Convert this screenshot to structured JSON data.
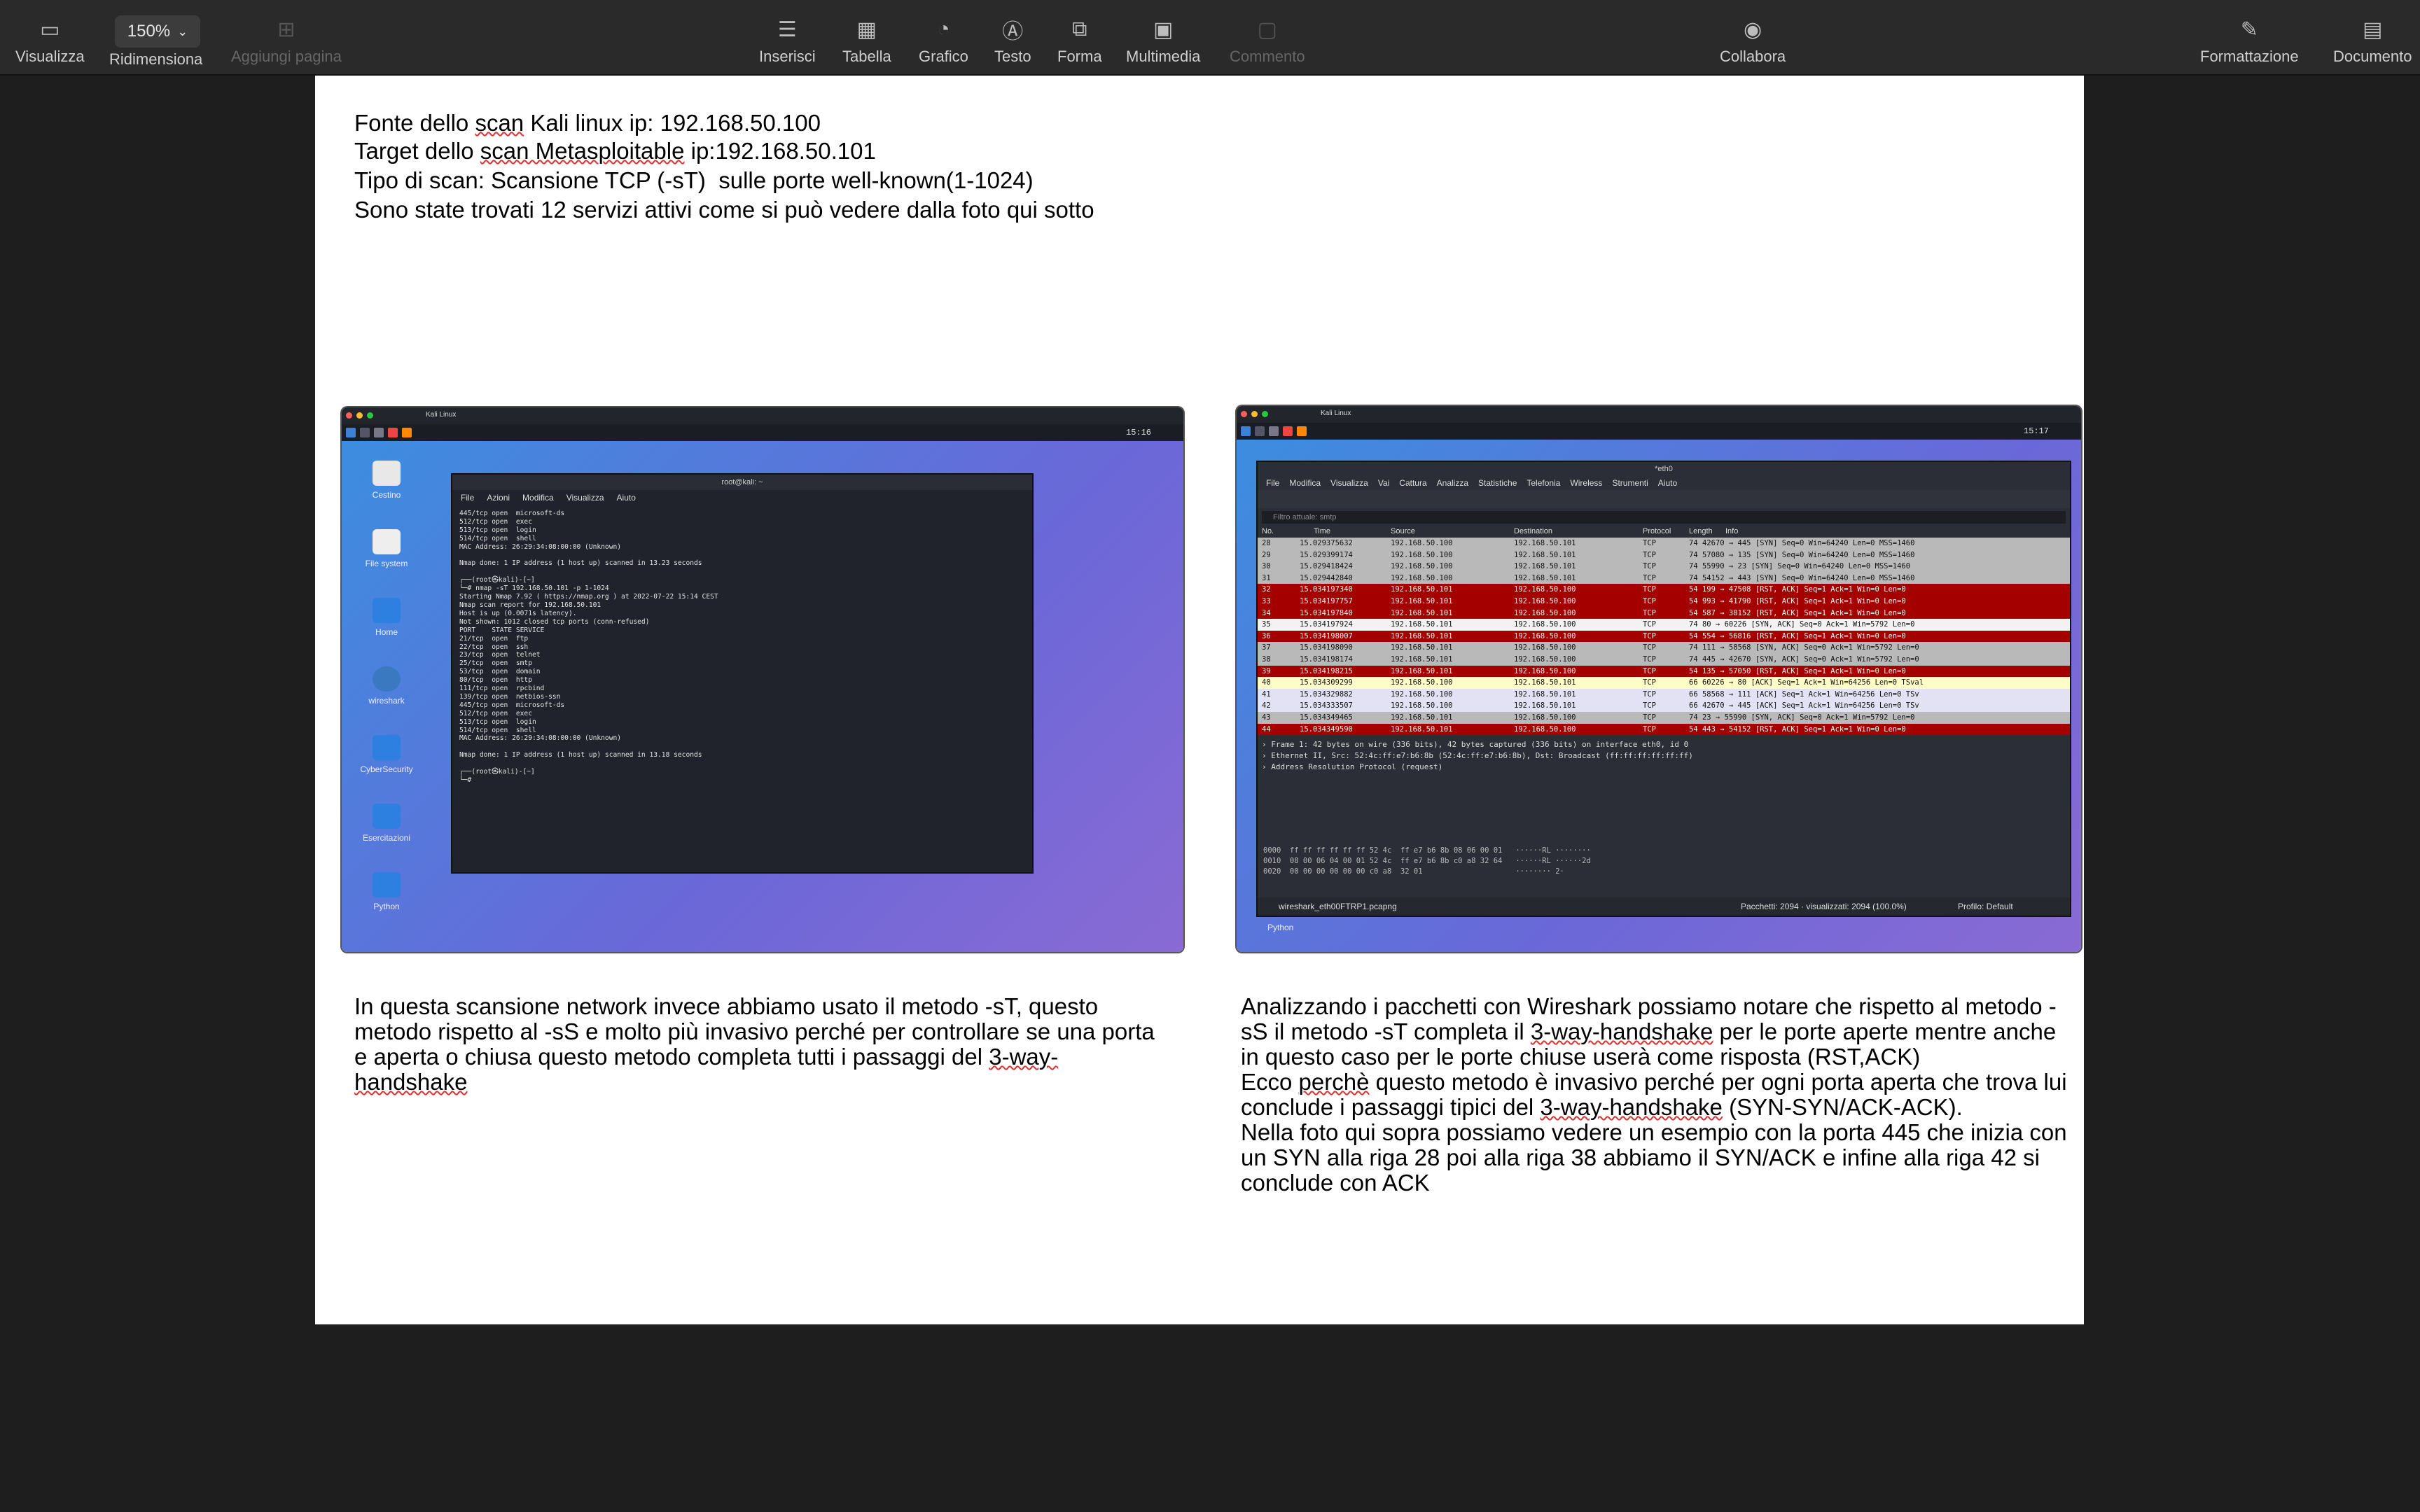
{
  "toolbar": {
    "view": "Visualizza",
    "zoom_value": "150%",
    "zoom_label": "Ridimensiona",
    "add_page": "Aggiungi pagina",
    "insert": "Inserisci",
    "table": "Tabella",
    "chart": "Grafico",
    "text": "Testo",
    "shape": "Forma",
    "media": "Multimedia",
    "comment": "Commento",
    "collaborate": "Collabora",
    "format": "Formattazione",
    "document": "Documento"
  },
  "intro": {
    "l1a": "Fonte dello ",
    "l1b": "scan",
    "l1c": " Kali linux ip: 192.168.50.100",
    "l2a": "Target dello ",
    "l2b": "scan Metasploitable",
    "l2c": " ip:192.168.50.101",
    "l3": "Tipo di scan: Scansione TCP (-sT)  sulle porte well-known(1-1024)",
    "l4": "Sono state trovati 12 servizi attivi come si può vedere dalla foto qui sotto"
  },
  "left_caption": {
    "a": "In questa scansione network invece abbiamo usato il metodo -sT, questo metodo rispetto al -sS e molto più invasivo perché per controllare se una porta e aperta o chiusa questo metodo completa tutti i passaggi del ",
    "b": "3-way-handshake"
  },
  "right_caption": {
    "a": "Analizzando i pacchetti con Wireshark possiamo notare che rispetto al metodo -sS il metodo -sT completa il ",
    "b": "3-way-handshake",
    "c": " per le porte aperte mentre anche in questo caso per le porte chiuse userà come risposta (RST,ACK)\nEcco ",
    "d": "perchè",
    "e": " questo metodo è invasivo perché per ogni porta aperta che trova lui conclude i passaggi tipici del ",
    "f": "3-way-handshake",
    "g": " (SYN-SYN/ACK-ACK).\nNella foto qui sopra possiamo vedere un esempio con la porta 445 che inizia con un SYN alla riga 28 poi alla riga 38 abbiamo il SYN/ACK e infine alla riga 42 si conclude con ACK"
  },
  "kali": {
    "window_title": "Kali Linux",
    "clock": "15:16",
    "desktop_icons": [
      "Cestino",
      "File system",
      "Home",
      "wireshark",
      "CyberSecurity",
      "Esercitazioni",
      "Python"
    ],
    "terminal_title": "root@kali: ~",
    "terminal_menu": [
      "File",
      "Azioni",
      "Modifica",
      "Visualizza",
      "Aiuto"
    ],
    "terminal_text": "445/tcp open  microsoft-ds\n512/tcp open  exec\n513/tcp open  login\n514/tcp open  shell\nMAC Address: 26:29:34:08:00:00 (Unknown)\n\nNmap done: 1 IP address (1 host up) scanned in 13.23 seconds\n\n┌──(root㉿kali)-[~]\n└─# nmap -sT 192.168.50.101 -p 1-1024\nStarting Nmap 7.92 ( https://nmap.org ) at 2022-07-22 15:14 CEST\nNmap scan report for 192.168.50.101\nHost is up (0.0071s latency).\nNot shown: 1012 closed tcp ports (conn-refused)\nPORT    STATE SERVICE\n21/tcp  open  ftp\n22/tcp  open  ssh\n23/tcp  open  telnet\n25/tcp  open  smtp\n53/tcp  open  domain\n80/tcp  open  http\n111/tcp open  rpcbind\n139/tcp open  netbios-ssn\n445/tcp open  microsoft-ds\n512/tcp open  exec\n513/tcp open  login\n514/tcp open  shell\nMAC Address: 26:29:34:08:00:00 (Unknown)\n\nNmap done: 1 IP address (1 host up) scanned in 13.18 seconds\n\n┌──(root㉿kali)-[~]\n└─# "
  },
  "wireshark": {
    "window_title": "Kali Linux",
    "clock": "15:17",
    "app_title": "*eth0",
    "menu": [
      "File",
      "Modifica",
      "Visualizza",
      "Vai",
      "Cattura",
      "Analizza",
      "Statistiche",
      "Telefonia",
      "Wireless",
      "Strumenti",
      "Aiuto"
    ],
    "filter_placeholder": "Filtro attuale: smtp",
    "columns": [
      "No.",
      "Time",
      "Source",
      "Destination",
      "Protocol",
      "Length",
      "Info"
    ],
    "packets": [
      {
        "no": "28",
        "time": "15.029375632",
        "src": "192.168.50.100",
        "dst": "192.168.50.101",
        "proto": "TCP",
        "info": "74 42670 → 445 [SYN] Seq=0 Win=64240 Len=0 MSS=1460",
        "bg": "#b9b9b9"
      },
      {
        "no": "29",
        "time": "15.029399174",
        "src": "192.168.50.100",
        "dst": "192.168.50.101",
        "proto": "TCP",
        "info": "74 57080 → 135 [SYN] Seq=0 Win=64240 Len=0 MSS=1460",
        "bg": "#b9b9b9"
      },
      {
        "no": "30",
        "time": "15.029418424",
        "src": "192.168.50.100",
        "dst": "192.168.50.101",
        "proto": "TCP",
        "info": "74 55990 → 23 [SYN] Seq=0 Win=64240 Len=0 MSS=1460",
        "bg": "#b9b9b9"
      },
      {
        "no": "31",
        "time": "15.029442840",
        "src": "192.168.50.100",
        "dst": "192.168.50.101",
        "proto": "TCP",
        "info": "74 54152 → 443 [SYN] Seq=0 Win=64240 Len=0 MSS=1460",
        "bg": "#b9b9b9"
      },
      {
        "no": "32",
        "time": "15.034197340",
        "src": "192.168.50.101",
        "dst": "192.168.50.100",
        "proto": "TCP",
        "info": "54 199 → 47508 [RST, ACK] Seq=1 Ack=1 Win=0 Len=0",
        "bg": "#a40000"
      },
      {
        "no": "33",
        "time": "15.034197757",
        "src": "192.168.50.101",
        "dst": "192.168.50.100",
        "proto": "TCP",
        "info": "54 993 → 41790 [RST, ACK] Seq=1 Ack=1 Win=0 Len=0",
        "bg": "#a40000"
      },
      {
        "no": "34",
        "time": "15.034197840",
        "src": "192.168.50.101",
        "dst": "192.168.50.100",
        "proto": "TCP",
        "info": "54 587 → 38152 [RST, ACK] Seq=1 Ack=1 Win=0 Len=0",
        "bg": "#a40000"
      },
      {
        "no": "35",
        "time": "15.034197924",
        "src": "192.168.50.101",
        "dst": "192.168.50.100",
        "proto": "TCP",
        "info": "74 80 → 60226 [SYN, ACK] Seq=0 Ack=1 Win=5792 Len=0",
        "bg": "#f2f2f2"
      },
      {
        "no": "36",
        "time": "15.034198007",
        "src": "192.168.50.101",
        "dst": "192.168.50.100",
        "proto": "TCP",
        "info": "54 554 → 56816 [RST, ACK] Seq=1 Ack=1 Win=0 Len=0",
        "bg": "#a40000"
      },
      {
        "no": "37",
        "time": "15.034198090",
        "src": "192.168.50.101",
        "dst": "192.168.50.100",
        "proto": "TCP",
        "info": "74 111 → 58568 [SYN, ACK] Seq=0 Ack=1 Win=5792 Len=0",
        "bg": "#b9b9b9"
      },
      {
        "no": "38",
        "time": "15.034198174",
        "src": "192.168.50.101",
        "dst": "192.168.50.100",
        "proto": "TCP",
        "info": "74 445 → 42670 [SYN, ACK] Seq=0 Ack=1 Win=5792 Len=0",
        "bg": "#b9b9b9"
      },
      {
        "no": "39",
        "time": "15.034198215",
        "src": "192.168.50.101",
        "dst": "192.168.50.100",
        "proto": "TCP",
        "info": "54 135 → 57050 [RST, ACK] Seq=1 Ack=1 Win=0 Len=0",
        "bg": "#a40000"
      },
      {
        "no": "40",
        "time": "15.034309299",
        "src": "192.168.50.100",
        "dst": "192.168.50.101",
        "proto": "TCP",
        "info": "66 60226 → 80 [ACK] Seq=1 Ack=1 Win=64256 Len=0 TSval",
        "bg": "#fdfdc8"
      },
      {
        "no": "41",
        "time": "15.034329882",
        "src": "192.168.50.100",
        "dst": "192.168.50.101",
        "proto": "TCP",
        "info": "66 58568 → 111 [ACK] Seq=1 Ack=1 Win=64256 Len=0 TSv",
        "bg": "#e2e2f4"
      },
      {
        "no": "42",
        "time": "15.034333507",
        "src": "192.168.50.100",
        "dst": "192.168.50.101",
        "proto": "TCP",
        "info": "66 42670 → 445 [ACK] Seq=1 Ack=1 Win=64256 Len=0 TSv",
        "bg": "#e2e2f4"
      },
      {
        "no": "43",
        "time": "15.034349465",
        "src": "192.168.50.101",
        "dst": "192.168.50.100",
        "proto": "TCP",
        "info": "74 23 → 55990 [SYN, ACK] Seq=0 Ack=1 Win=5792 Len=0",
        "bg": "#b9b9b9"
      },
      {
        "no": "44",
        "time": "15.034349590",
        "src": "192.168.50.101",
        "dst": "192.168.50.100",
        "proto": "TCP",
        "info": "54 443 → 54152 [RST, ACK] Seq=1 Ack=1 Win=0 Len=0",
        "bg": "#a40000"
      }
    ],
    "detail": "› Frame 1: 42 bytes on wire (336 bits), 42 bytes captured (336 bits) on interface eth0, id 0\n› Ethernet II, Src: 52:4c:ff:e7:b6:8b (52:4c:ff:e7:b6:8b), Dst: Broadcast (ff:ff:ff:ff:ff:ff)\n› Address Resolution Protocol (request)",
    "hex": "0000  ff ff ff ff ff ff 52 4c  ff e7 b6 8b 08 06 00 01   ······RL ········\n0010  08 00 06 04 00 01 52 4c  ff e7 b6 8b c0 a8 32 64   ······RL ······2d\n0020  00 00 00 00 00 00 c0 a8  32 01                     ········ 2·",
    "file": "wireshark_eth00FTRP1.pcapng",
    "packets_status": "Pacchetti: 2094 · visualizzati: 2094 (100.0%)",
    "profile": "Profilo: Default",
    "dock_label": "Python"
  }
}
